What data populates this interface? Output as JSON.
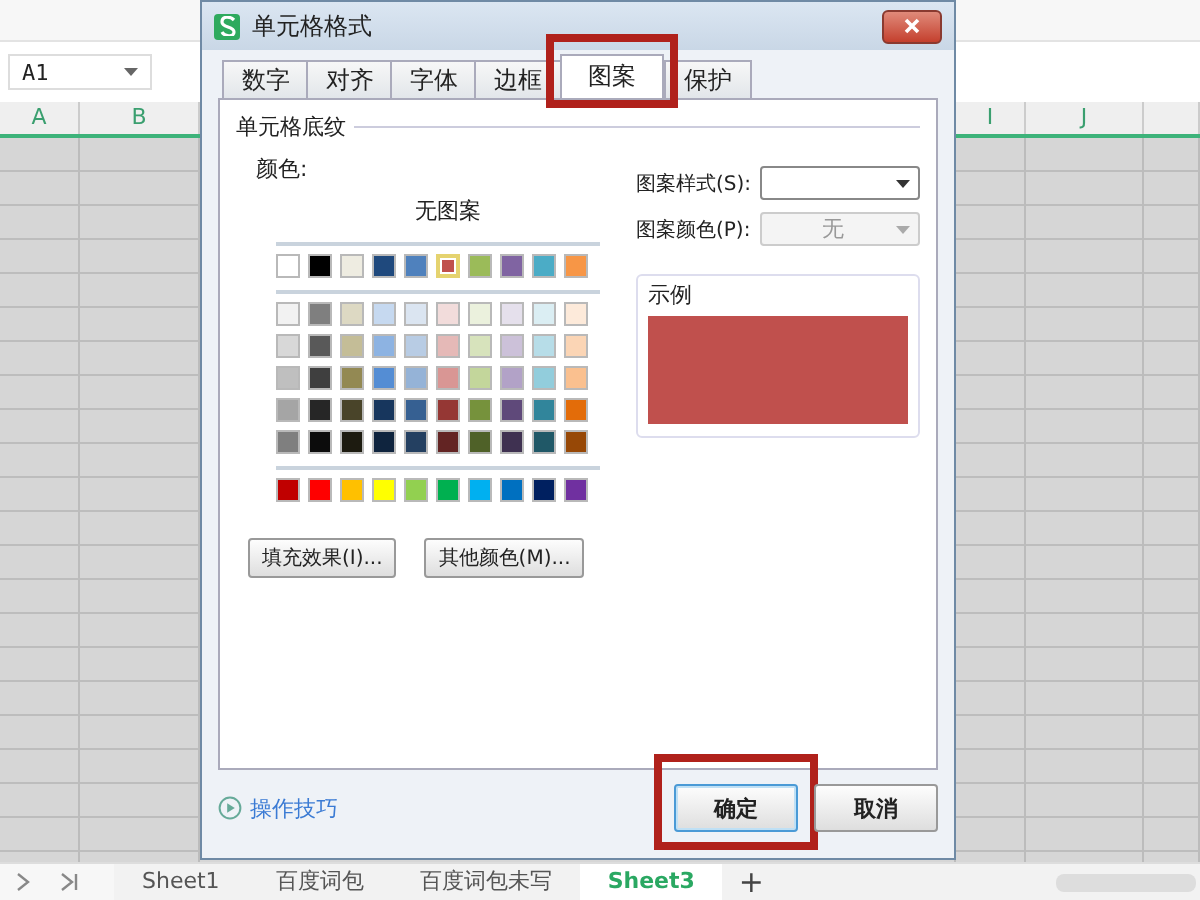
{
  "name_box": {
    "value": "A1"
  },
  "column_headers": [
    {
      "label": "A",
      "kind": "narrow"
    },
    {
      "label": "B",
      "kind": "wide"
    },
    {
      "label": "I",
      "kind": "narrow"
    },
    {
      "label": "J",
      "kind": "wide"
    }
  ],
  "dialog": {
    "title": "单元格格式",
    "tabs": [
      {
        "label": "数字",
        "selected": false,
        "highlighted": false
      },
      {
        "label": "对齐",
        "selected": false,
        "highlighted": false
      },
      {
        "label": "字体",
        "selected": false,
        "highlighted": false
      },
      {
        "label": "边框",
        "selected": false,
        "highlighted": false
      },
      {
        "label": "图案",
        "selected": true,
        "highlighted": true
      },
      {
        "label": "保护",
        "selected": false,
        "highlighted": false
      }
    ],
    "group_title": "单元格底纹",
    "color_label": "颜色:",
    "no_pattern": "无图案",
    "palette_sections": [
      {
        "rows": [
          {
            "swatches": [
              {
                "color": "#ffffff",
                "selected": false
              },
              {
                "color": "#000000",
                "selected": false
              },
              {
                "color": "#eeece1",
                "selected": false
              },
              {
                "color": "#1f497d",
                "selected": false
              },
              {
                "color": "#4f81bd",
                "selected": false
              },
              {
                "color": "#c0504d",
                "selected": true
              },
              {
                "color": "#9bbb59",
                "selected": false
              },
              {
                "color": "#8064a2",
                "selected": false
              },
              {
                "color": "#4bacc6",
                "selected": false
              },
              {
                "color": "#f79646",
                "selected": false
              }
            ]
          }
        ]
      },
      {
        "rows": [
          {
            "swatches": [
              {
                "color": "#f2f2f2",
                "selected": false
              },
              {
                "color": "#7f7f7f",
                "selected": false
              },
              {
                "color": "#ddd9c3",
                "selected": false
              },
              {
                "color": "#c6d9f0",
                "selected": false
              },
              {
                "color": "#dbe5f1",
                "selected": false
              },
              {
                "color": "#f2dcdb",
                "selected": false
              },
              {
                "color": "#ebf1dd",
                "selected": false
              },
              {
                "color": "#e5e0ec",
                "selected": false
              },
              {
                "color": "#dbeef3",
                "selected": false
              },
              {
                "color": "#fdeada",
                "selected": false
              }
            ]
          },
          {
            "swatches": [
              {
                "color": "#d8d8d8",
                "selected": false
              },
              {
                "color": "#595959",
                "selected": false
              },
              {
                "color": "#c4bd97",
                "selected": false
              },
              {
                "color": "#8db3e2",
                "selected": false
              },
              {
                "color": "#b8cce4",
                "selected": false
              },
              {
                "color": "#e5b9b7",
                "selected": false
              },
              {
                "color": "#d7e3bc",
                "selected": false
              },
              {
                "color": "#ccc1d9",
                "selected": false
              },
              {
                "color": "#b7dde8",
                "selected": false
              },
              {
                "color": "#fbd5b5",
                "selected": false
              }
            ]
          },
          {
            "swatches": [
              {
                "color": "#bfbfbf",
                "selected": false
              },
              {
                "color": "#3f3f3f",
                "selected": false
              },
              {
                "color": "#938953",
                "selected": false
              },
              {
                "color": "#548dd4",
                "selected": false
              },
              {
                "color": "#95b3d7",
                "selected": false
              },
              {
                "color": "#d99694",
                "selected": false
              },
              {
                "color": "#c3d69b",
                "selected": false
              },
              {
                "color": "#b2a2c7",
                "selected": false
              },
              {
                "color": "#92cddc",
                "selected": false
              },
              {
                "color": "#fac08f",
                "selected": false
              }
            ]
          },
          {
            "swatches": [
              {
                "color": "#a5a5a5",
                "selected": false
              },
              {
                "color": "#262626",
                "selected": false
              },
              {
                "color": "#494429",
                "selected": false
              },
              {
                "color": "#17365d",
                "selected": false
              },
              {
                "color": "#366092",
                "selected": false
              },
              {
                "color": "#953734",
                "selected": false
              },
              {
                "color": "#76923c",
                "selected": false
              },
              {
                "color": "#5f497a",
                "selected": false
              },
              {
                "color": "#31859b",
                "selected": false
              },
              {
                "color": "#e36c09",
                "selected": false
              }
            ]
          },
          {
            "swatches": [
              {
                "color": "#7f7f7f",
                "selected": false
              },
              {
                "color": "#0c0c0c",
                "selected": false
              },
              {
                "color": "#1d1b10",
                "selected": false
              },
              {
                "color": "#0f243e",
                "selected": false
              },
              {
                "color": "#244061",
                "selected": false
              },
              {
                "color": "#632423",
                "selected": false
              },
              {
                "color": "#4f6128",
                "selected": false
              },
              {
                "color": "#3f3151",
                "selected": false
              },
              {
                "color": "#205867",
                "selected": false
              },
              {
                "color": "#974806",
                "selected": false
              }
            ]
          }
        ]
      },
      {
        "rows": [
          {
            "swatches": [
              {
                "color": "#c00000",
                "selected": false
              },
              {
                "color": "#ff0000",
                "selected": false
              },
              {
                "color": "#ffc000",
                "selected": false
              },
              {
                "color": "#ffff00",
                "selected": false
              },
              {
                "color": "#92d050",
                "selected": false
              },
              {
                "color": "#00b050",
                "selected": false
              },
              {
                "color": "#00b0f0",
                "selected": false
              },
              {
                "color": "#0070c0",
                "selected": false
              },
              {
                "color": "#002060",
                "selected": false
              },
              {
                "color": "#7030a0",
                "selected": false
              }
            ]
          }
        ]
      }
    ],
    "buttons": [
      "填充效果(I)...",
      "其他颜色(M)..."
    ],
    "pattern_style": {
      "label": "图案样式(S):",
      "disabled": false
    },
    "pattern_color": {
      "label": "图案颜色(P):",
      "value": "无",
      "disabled": true
    },
    "sample_label": "示例",
    "tips_link": "操作技巧",
    "ok_button": {
      "label": "确定",
      "focused": true,
      "highlighted": true
    },
    "cancel_button": {
      "label": "取消",
      "focused": false,
      "highlighted": false
    }
  },
  "sheet_tabs": [
    {
      "label": "Sheet1",
      "selected": false
    },
    {
      "label": "百度词包",
      "selected": false
    },
    {
      "label": "百度词包未写",
      "selected": false
    },
    {
      "label": "Sheet3",
      "selected": true
    }
  ],
  "add_sheet": "+"
}
